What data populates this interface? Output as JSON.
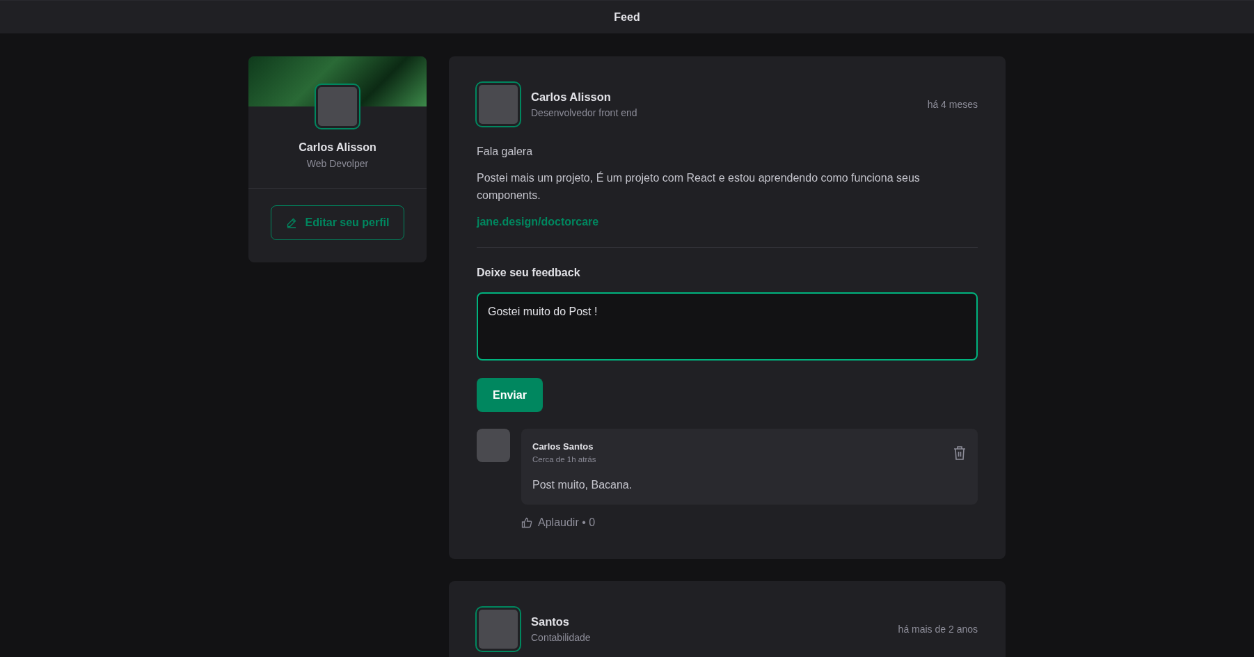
{
  "header": {
    "title": "Feed"
  },
  "profile": {
    "name": "Carlos Alisson",
    "role": "Web Devolper",
    "edit_button": "Editar seu perfil"
  },
  "posts": [
    {
      "author": {
        "name": "Carlos Alisson",
        "role": "Desenvolvedor front end"
      },
      "time": "há 4 meses",
      "content": [
        {
          "kind": "paragraph",
          "text": "Fala galera"
        },
        {
          "kind": "paragraph",
          "text": "Postei mais um projeto, É um projeto com React e estou aprendendo como funciona seus components."
        },
        {
          "kind": "link",
          "text": "jane.design/doctorcare"
        }
      ],
      "feedback": {
        "title": "Deixe seu feedback",
        "value": "Gostei muito do Post !",
        "button": "Enviar"
      },
      "comments": [
        {
          "author": "Carlos Santos",
          "time": "Cerca de 1h atrás",
          "text": "Post muito, Bacana.",
          "applaud": "Aplaudir • 0"
        }
      ]
    },
    {
      "author": {
        "name": "Santos",
        "role": "Contabilidade"
      },
      "time": "há mais de 2 anos"
    }
  ]
}
